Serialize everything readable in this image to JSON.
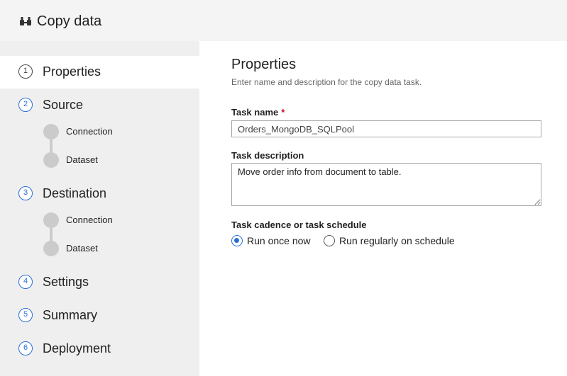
{
  "header": {
    "title": "Copy data",
    "icon": "copy-data-icon"
  },
  "sidebar": {
    "steps": [
      {
        "number": "1",
        "label": "Properties",
        "active": true
      },
      {
        "number": "2",
        "label": "Source",
        "substeps": [
          "Connection",
          "Dataset"
        ]
      },
      {
        "number": "3",
        "label": "Destination",
        "substeps": [
          "Connection",
          "Dataset"
        ]
      },
      {
        "number": "4",
        "label": "Settings"
      },
      {
        "number": "5",
        "label": "Summary"
      },
      {
        "number": "6",
        "label": "Deployment"
      }
    ]
  },
  "main": {
    "heading": "Properties",
    "subheading": "Enter name and description for the copy data task.",
    "task_name": {
      "label": "Task name",
      "required_mark": "*",
      "value": "Orders_MongoDB_SQLPool"
    },
    "task_description": {
      "label": "Task description",
      "value": "Move order info from document to table."
    },
    "cadence": {
      "label": "Task cadence or task schedule",
      "options": [
        {
          "label": "Run once now",
          "selected": true
        },
        {
          "label": "Run regularly on schedule",
          "selected": false
        }
      ]
    }
  },
  "colors": {
    "accent": "#2b6fd6",
    "required": "#c50f1f",
    "sidebar_bg": "#efefef",
    "substep_dot": "#cbcbcb"
  }
}
